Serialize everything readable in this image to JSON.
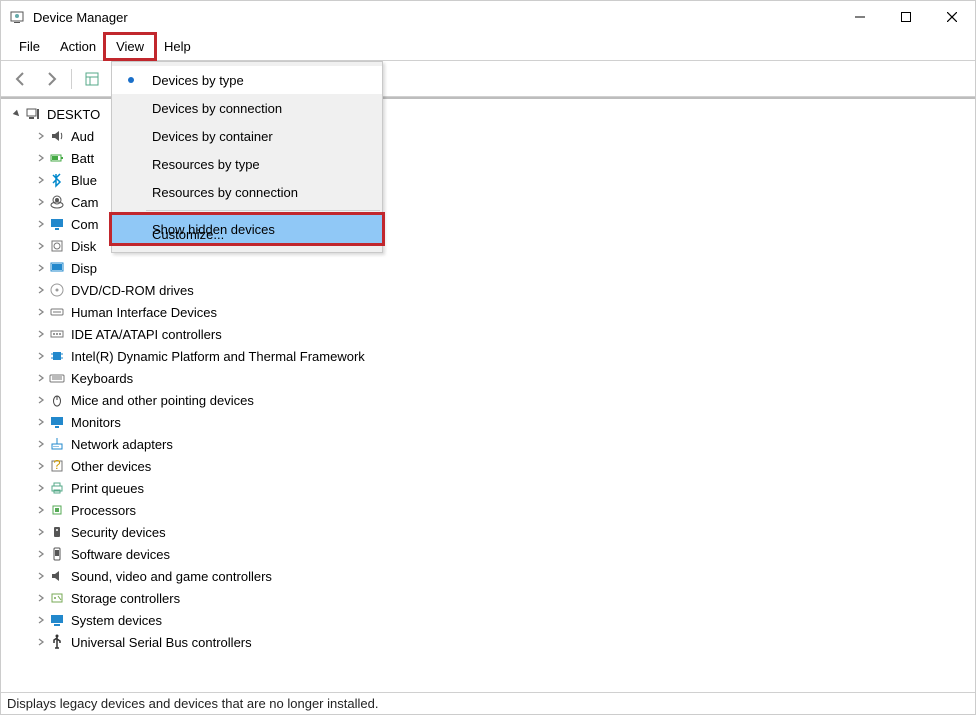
{
  "window": {
    "title": "Device Manager"
  },
  "menu": {
    "file": "File",
    "action": "Action",
    "view": "View",
    "help": "Help"
  },
  "viewMenu": {
    "items": [
      "Devices by type",
      "Devices by connection",
      "Devices by container",
      "Resources by type",
      "Resources by connection",
      "Show hidden devices",
      "Customize..."
    ]
  },
  "tree": {
    "root": "DESKTO",
    "nodes": [
      {
        "label": "Aud",
        "icon": "speaker"
      },
      {
        "label": "Batt",
        "icon": "battery"
      },
      {
        "label": "Blue",
        "icon": "bluetooth"
      },
      {
        "label": "Cam",
        "icon": "camera"
      },
      {
        "label": "Com",
        "icon": "monitor"
      },
      {
        "label": "Disk",
        "icon": "disk"
      },
      {
        "label": "Disp",
        "icon": "display"
      },
      {
        "label": "DVD/CD-ROM drives",
        "icon": "dvd"
      },
      {
        "label": "Human Interface Devices",
        "icon": "hid"
      },
      {
        "label": "IDE ATA/ATAPI controllers",
        "icon": "ide"
      },
      {
        "label": "Intel(R) Dynamic Platform and Thermal Framework",
        "icon": "chip"
      },
      {
        "label": "Keyboards",
        "icon": "keyboard"
      },
      {
        "label": "Mice and other pointing devices",
        "icon": "mouse"
      },
      {
        "label": "Monitors",
        "icon": "monitor"
      },
      {
        "label": "Network adapters",
        "icon": "network"
      },
      {
        "label": "Other devices",
        "icon": "other"
      },
      {
        "label": "Print queues",
        "icon": "printer"
      },
      {
        "label": "Processors",
        "icon": "cpu"
      },
      {
        "label": "Security devices",
        "icon": "security"
      },
      {
        "label": "Software devices",
        "icon": "software"
      },
      {
        "label": "Sound, video and game controllers",
        "icon": "sound"
      },
      {
        "label": "Storage controllers",
        "icon": "storage"
      },
      {
        "label": "System devices",
        "icon": "system"
      },
      {
        "label": "Universal Serial Bus controllers",
        "icon": "usb"
      }
    ]
  },
  "status": "Displays legacy devices and devices that are no longer installed."
}
